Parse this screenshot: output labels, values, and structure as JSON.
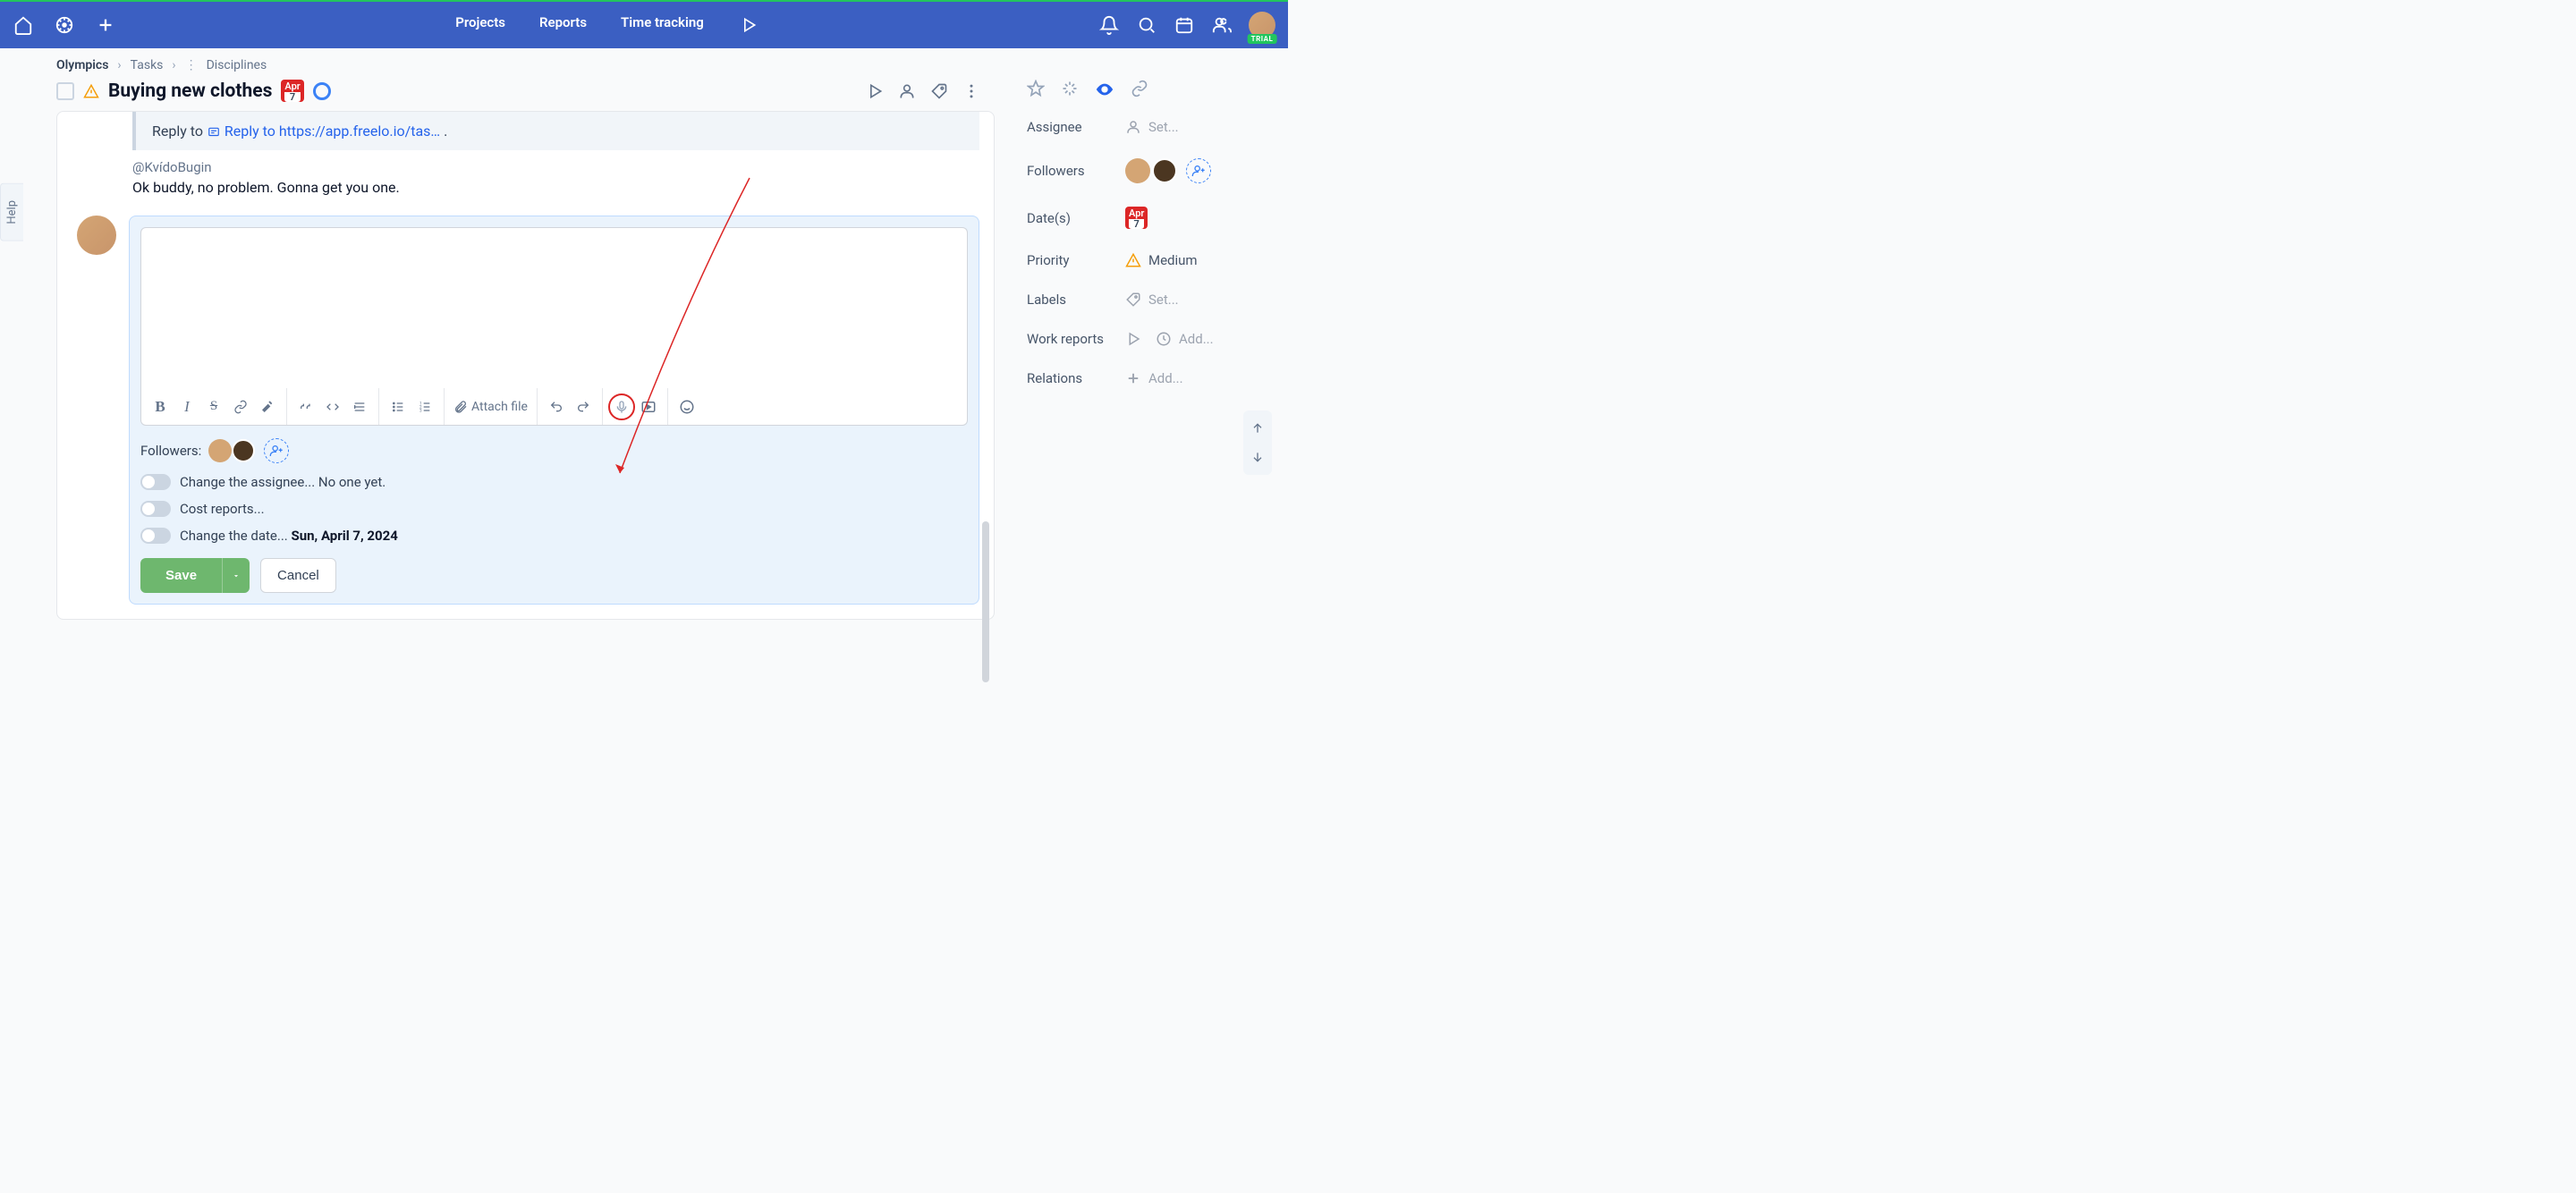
{
  "topnav": {
    "projects": "Projects",
    "reports": "Reports",
    "time_tracking": "Time tracking",
    "trial_badge": "TRIAL"
  },
  "help_tab": "Help",
  "breadcrumb": {
    "project": "Olympics",
    "tasks": "Tasks",
    "section": "Disciplines"
  },
  "task": {
    "title": "Buying new clothes",
    "date_month": "Apr",
    "date_day": "7"
  },
  "reply_box": {
    "prefix": "Reply to ",
    "link_text": "Reply to https://app.freelo.io/tas…",
    "suffix": " ."
  },
  "mention": "@KvídoBugin",
  "message": "Ok buddy, no problem. Gonna get you one.",
  "toolbar": {
    "attach": "Attach file"
  },
  "followers_label": "Followers:",
  "options": {
    "assignee": "Change the assignee... No one yet.",
    "cost": "Cost reports...",
    "date_prefix": "Change the date... ",
    "date_value": "Sun, April 7, 2024"
  },
  "buttons": {
    "save": "Save",
    "cancel": "Cancel"
  },
  "sidebar": {
    "assignee_label": "Assignee",
    "assignee_set": "Set...",
    "followers_label": "Followers",
    "dates_label": "Date(s)",
    "dates_month": "Apr",
    "dates_day": "7",
    "priority_label": "Priority",
    "priority_value": "Medium",
    "labels_label": "Labels",
    "labels_set": "Set...",
    "work_label": "Work reports",
    "work_add": "Add...",
    "relations_label": "Relations",
    "relations_add": "Add..."
  }
}
